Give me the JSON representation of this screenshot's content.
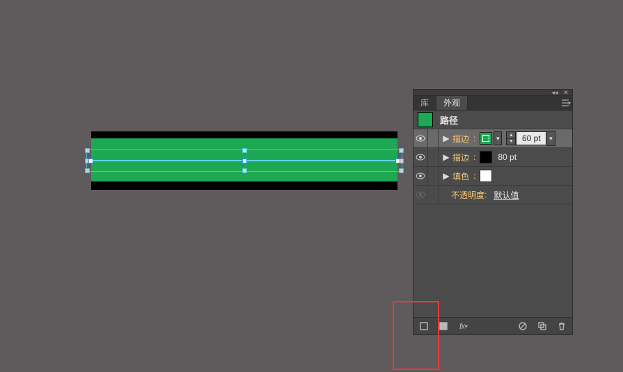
{
  "canvas": {
    "object_type": "path_with_strokes",
    "outer_stroke_color": "#000000",
    "inner_stroke_color": "#1da854",
    "path_color": "#62d2ff"
  },
  "panel": {
    "tabs": {
      "library": "库",
      "appearance": "外观"
    },
    "selection": {
      "thumb_color": "#1da854",
      "label": "路径"
    },
    "rows": [
      {
        "kind": "stroke",
        "selected": true,
        "label": "描边",
        "color": "#1da854",
        "weight_value": "60 pt",
        "show_weight_field": true
      },
      {
        "kind": "stroke",
        "selected": false,
        "label": "描边",
        "color": "#000000",
        "weight_text": "80 pt"
      },
      {
        "kind": "fill",
        "selected": false,
        "label": "填色",
        "color": "#ffffff"
      },
      {
        "kind": "opacity",
        "selected": false,
        "label": "不透明度",
        "value": "默认值"
      }
    ],
    "footer": {
      "new_stroke_title": "新建描边",
      "new_fill_title": "新建填充",
      "fx_label": "fx",
      "clear_title": "清除外观",
      "dup_title": "复制所选项目",
      "trash_title": "删除所选项目"
    }
  }
}
